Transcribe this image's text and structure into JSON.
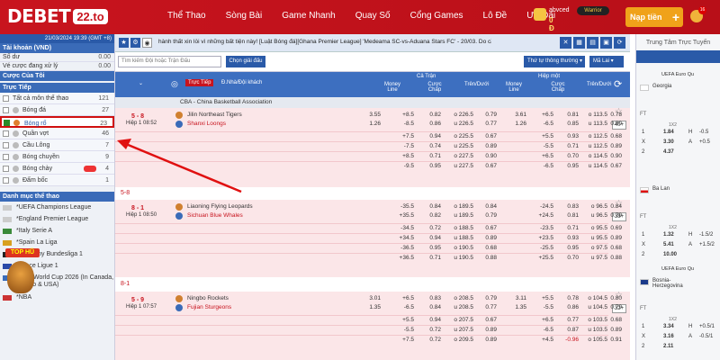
{
  "brand": {
    "logo_text": "DEBET",
    "tld": "22.to"
  },
  "nav": {
    "items": [
      "Thể Thao",
      "Sòng Bài",
      "Game Nhanh",
      "Quay Số",
      "Cổng Games",
      "Lô Đề",
      "Ưu Đãi"
    ]
  },
  "user": {
    "name": "abvced",
    "balance": "0 Đ",
    "badge": "Warrior"
  },
  "deposit": {
    "label": "Nạp tiền",
    "plus": "+"
  },
  "notif": {
    "count": "16"
  },
  "sidebar": {
    "datetime": "21/03/2024 19:39 (GMT +8)",
    "account": {
      "title": "Tài khoản (VND)",
      "rows": [
        {
          "label": "Số dư",
          "value": "0.00"
        },
        {
          "label": "Vé cược đang xử lý",
          "value": "0.00"
        }
      ]
    },
    "my_bets": "Cược Của Tôi",
    "live": {
      "title": "Trực Tiếp",
      "sports": [
        {
          "label": "Tất cả môn thể thao",
          "count": "121"
        },
        {
          "label": "Bóng đá",
          "count": "27"
        },
        {
          "label": "Bóng rổ",
          "count": "23"
        },
        {
          "label": "Quần vợt",
          "count": "46"
        },
        {
          "label": "Cầu Lông",
          "count": "7"
        },
        {
          "label": "Bóng chuyền",
          "count": "9"
        },
        {
          "label": "Bóng chày",
          "count": "4"
        },
        {
          "label": "Đấm bốc",
          "count": "1"
        }
      ]
    },
    "categories_title": "Danh mục thể thao",
    "leagues": [
      "*UEFA Champions League",
      "*England Premier League",
      "*Italy Serie A",
      "*Spain La Liga",
      "*Germany Bundesliga 1",
      "France Ligue 1",
      "*FIFA World Cup 2026 (In Canada, Mexico & USA)",
      "*NBA"
    ],
    "top_hu": "TOP HŨ"
  },
  "ticker": {
    "text": "hành thất xin lỗi vì những bất tiện này!    [Luật Bóng đá][Ghana Premier League] 'Medeama SC-vs-Aduana Stars FC' - 20/03. Do cần điều tra th"
  },
  "filter": {
    "search_placeholder": "Tìm kiếm Đội hoặc Trận Đấu",
    "choose_btn": "Chọn giải đấu",
    "sort": "Thứ tự thông thường",
    "odds": "Mã Lai"
  },
  "table_head": {
    "live": "Trực Tiếp",
    "teams": "Đ.Nhà/Đội khách",
    "full": "Cả Trận",
    "half": "Hiệp một",
    "ml": "Money Line",
    "hcp": "Cược Chấp",
    "ou": "Trên/Dưới"
  },
  "league": "CBA - China Basketball Association",
  "matches": [
    {
      "score": "5 - 8",
      "time": "Hiệp 1 08:52",
      "home": "Jilin Northeast Tigers",
      "away": "Shanxi Loongs",
      "more": "40+",
      "main": [
        [
          "3.55",
          "+8.5",
          "0.82",
          "o 226.5",
          "0.79",
          "3.61",
          "+6.5",
          "0.81",
          "o 113.5",
          "0.78"
        ],
        [
          "1.26",
          "-8.5",
          "0.86",
          "u 226.5",
          "0.77",
          "1.26",
          "-6.5",
          "0.85",
          "u 113.5",
          "0.80"
        ]
      ],
      "alt": [
        [
          "",
          "+7.5",
          "0.94",
          "o 225.5",
          "0.67",
          "",
          "+5.5",
          "0.93",
          "o 112.5",
          "0.68"
        ],
        [
          "",
          "-7.5",
          "0.74",
          "u 225.5",
          "0.89",
          "",
          "-5.5",
          "0.71",
          "u 112.5",
          "0.89"
        ],
        [
          "",
          "+8.5",
          "0.71",
          "o 227.5",
          "0.90",
          "",
          "+6.5",
          "0.70",
          "o 114.5",
          "0.90"
        ],
        [
          "",
          "-9.5",
          "0.95",
          "u 227.5",
          "0.67",
          "",
          "-6.5",
          "0.95",
          "u 114.5",
          "0.67"
        ]
      ]
    },
    {
      "score": "8 - 1",
      "time": "Hiệp 1 08:50",
      "home": "Liaoning Flying Leopards",
      "away": "Sichuan Blue Whales",
      "more": "38+",
      "main": [
        [
          "",
          "-35.5",
          "0.84",
          "o 189.5",
          "0.84",
          "",
          "-24.5",
          "0.83",
          "o 96.5",
          "0.84"
        ],
        [
          "",
          "+35.5",
          "0.82",
          "u 189.5",
          "0.79",
          "",
          "+24.5",
          "0.81",
          "u 96.5",
          "0.79"
        ]
      ],
      "alt": [
        [
          "",
          "-34.5",
          "0.72",
          "o 188.5",
          "0.67",
          "",
          "-23.5",
          "0.71",
          "o 95.5",
          "0.69"
        ],
        [
          "",
          "+34.5",
          "0.94",
          "u 188.5",
          "0.89",
          "",
          "+23.5",
          "0.93",
          "u 95.5",
          "0.89"
        ],
        [
          "",
          "-36.5",
          "0.95",
          "o 190.5",
          "0.68",
          "",
          "-25.5",
          "0.95",
          "o 97.5",
          "0.68"
        ],
        [
          "",
          "+36.5",
          "0.71",
          "u 190.5",
          "0.88",
          "",
          "+25.5",
          "0.70",
          "u 97.5",
          "0.88"
        ]
      ]
    },
    {
      "score": "5 - 9",
      "time": "Hiệp 1 07:57",
      "home": "Ningbo Rockets",
      "away": "Fujian Sturgeons",
      "more": "32+",
      "main": [
        [
          "3.01",
          "+6.5",
          "0.83",
          "o 208.5",
          "0.79",
          "3.11",
          "+5.5",
          "0.78",
          "o 104.5",
          "0.80"
        ],
        [
          "1.35",
          "-6.5",
          "0.84",
          "u 208.5",
          "0.77",
          "1.35",
          "-5.5",
          "0.86",
          "u 104.5",
          "0.79"
        ]
      ],
      "alt": [
        [
          "",
          "+5.5",
          "0.94",
          "o 207.5",
          "0.67",
          "",
          "+6.5",
          "0.77",
          "o 103.5",
          "0.68"
        ],
        [
          "",
          "-5.5",
          "0.72",
          "u 207.5",
          "0.89",
          "",
          "-6.5",
          "0.87",
          "u 103.5",
          "0.89"
        ],
        [
          "",
          "+7.5",
          "0.72",
          "o 209.5",
          "0.89",
          "",
          "+4.5",
          "-0.96",
          "o 105.5",
          "0.91"
        ]
      ]
    }
  ],
  "gaps": [
    "5-8",
    "8-1"
  ],
  "right": {
    "title": "Trung Tâm Trực Tuyến",
    "matches": [
      {
        "league": "UEFA Euro Qu",
        "team": "Georgia",
        "status": "FT",
        "label": "1X2",
        "rows": [
          [
            "1",
            "1.84",
            "H",
            "-0.5"
          ],
          [
            "X",
            "3.30",
            "A",
            "+0.5"
          ],
          [
            "2",
            "4.37",
            "",
            ""
          ]
        ]
      },
      {
        "league": "",
        "team": "Ba Lan",
        "status": "FT",
        "label": "1X2",
        "rows": [
          [
            "1",
            "1.32",
            "H",
            "-1.5/2"
          ],
          [
            "X",
            "5.41",
            "A",
            "+1.5/2"
          ],
          [
            "2",
            "10.00",
            "",
            ""
          ]
        ]
      },
      {
        "league": "UEFA Euro Qu",
        "team": "Bosnia-Herzegovina",
        "status": "FT",
        "label": "1X2",
        "rows": [
          [
            "1",
            "3.34",
            "H",
            "+0.5/1"
          ],
          [
            "X",
            "3.16",
            "A",
            "-0.5/1"
          ],
          [
            "2",
            "2.11",
            "",
            ""
          ]
        ]
      }
    ]
  }
}
